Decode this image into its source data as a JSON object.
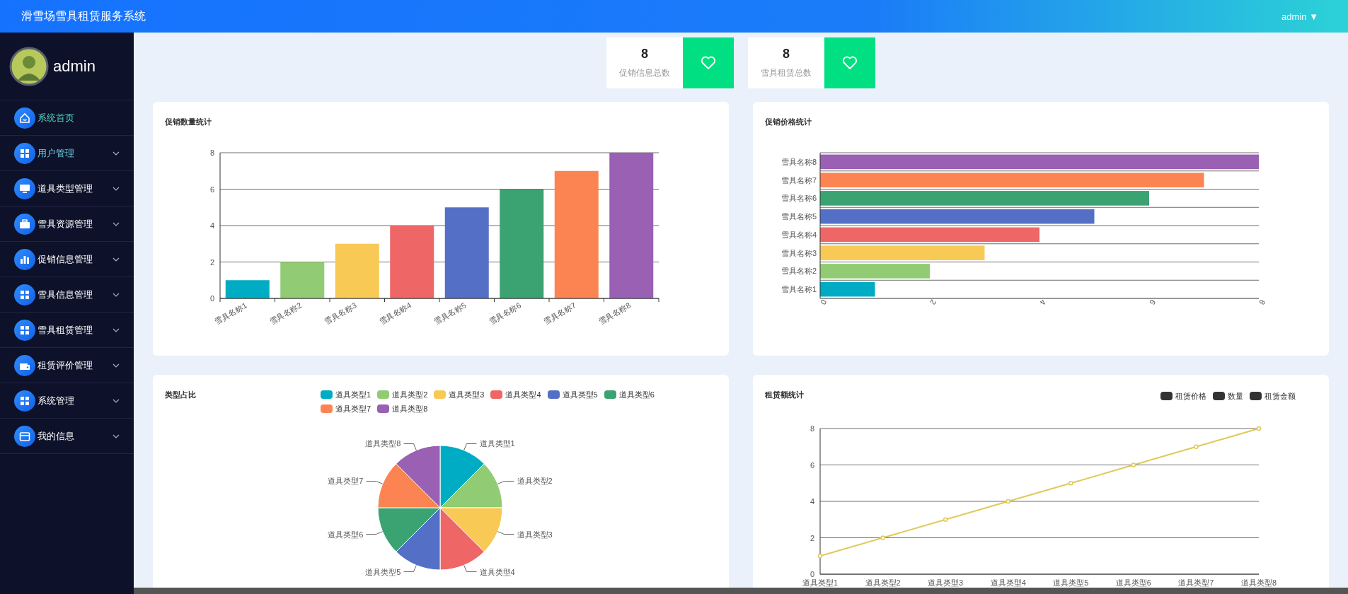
{
  "top_bar": {
    "title": "滑雪场雪具租赁服务系统",
    "user": "admin",
    "caret": "▼"
  },
  "sidebar": {
    "user": "admin",
    "items": [
      {
        "label": "系统首页",
        "kind": "home",
        "selected": true,
        "hovered": false
      },
      {
        "label": "用户管理",
        "kind": "grid",
        "selected": false,
        "hovered": true,
        "expanded": false
      },
      {
        "label": "道具类型管理",
        "kind": "monitor",
        "selected": false,
        "hovered": false,
        "expanded": false
      },
      {
        "label": "雪具资源管理",
        "kind": "briefcase",
        "selected": false,
        "hovered": false,
        "expanded": false
      },
      {
        "label": "促销信息管理",
        "kind": "barchart",
        "selected": false,
        "hovered": false,
        "expanded": false
      },
      {
        "label": "雪具信息管理",
        "kind": "grid",
        "selected": false,
        "hovered": false,
        "expanded": false
      },
      {
        "label": "雪具租赁管理",
        "kind": "grid",
        "selected": false,
        "hovered": false,
        "expanded": false
      },
      {
        "label": "租赁评价管理",
        "kind": "wallet",
        "selected": false,
        "hovered": false,
        "expanded": false
      },
      {
        "label": "系统管理",
        "kind": "grid",
        "selected": false,
        "hovered": false,
        "expanded": false
      },
      {
        "label": "我的信息",
        "kind": "card",
        "selected": false,
        "hovered": false,
        "expanded": false
      }
    ]
  },
  "stats": [
    {
      "value": "8",
      "label": "促销信息总数"
    },
    {
      "value": "8",
      "label": "雪具租赁总数"
    }
  ],
  "panels": [
    {
      "title": "促销数量统计",
      "bars": [
        {
          "color": "#00acc4"
        },
        {
          "color": "#91cc75"
        },
        {
          "color": "#f9c956"
        },
        {
          "color": "#ee6666"
        },
        {
          "color": "#5470c6"
        },
        {
          "color": "#3ba272"
        },
        {
          "color": "#fc8452"
        },
        {
          "color": "#9a60b4"
        }
      ],
      "chart_data": {
        "type": "bar",
        "grid": true,
        "categories": [
          "雪具名称1",
          "雪具名称2",
          "雪具名称3",
          "雪具名称4",
          "雪具名称5",
          "雪具名称6",
          "雪具名称7",
          "雪具名称8"
        ],
        "values": [
          1,
          2,
          3,
          4,
          5,
          6,
          7,
          8
        ],
        "ylim": [
          0,
          8
        ],
        "yticks": [
          0,
          2,
          4,
          6,
          8
        ]
      }
    },
    {
      "title": "促销价格统计",
      "bars": [
        {
          "color": "#9a60b4"
        },
        {
          "color": "#fc8452"
        },
        {
          "color": "#3ba272"
        },
        {
          "color": "#5470c6"
        },
        {
          "color": "#ee6666"
        },
        {
          "color": "#f9c956"
        },
        {
          "color": "#91cc75"
        },
        {
          "color": "#00acc4"
        }
      ],
      "chart_data": {
        "type": "bar",
        "orientation": "horizontal",
        "grid": true,
        "categories": [
          "雪具名称8",
          "雪具名称7",
          "雪具名称6",
          "雪具名称5",
          "雪具名称4",
          "雪具名称3",
          "雪具名称2",
          "雪具名称1"
        ],
        "values": [
          8,
          7,
          6,
          5,
          4,
          3,
          2,
          1
        ],
        "xlim": [
          0,
          8
        ],
        "xticks": [
          0,
          2,
          4,
          6,
          8
        ]
      }
    },
    {
      "title": "类型占比",
      "legend": [
        {
          "label": "道具类型1",
          "color": "#00acc4"
        },
        {
          "label": "道具类型2",
          "color": "#91cc75"
        },
        {
          "label": "道具类型3",
          "color": "#f9c956"
        },
        {
          "label": "道具类型4",
          "color": "#ee6666"
        },
        {
          "label": "道具类型5",
          "color": "#5470c6"
        },
        {
          "label": "道具类型6",
          "color": "#3ba272"
        },
        {
          "label": "道具类型7",
          "color": "#fc8452"
        },
        {
          "label": "道具类型8",
          "color": "#9a60b4"
        }
      ],
      "bars": [
        {
          "color": "#00acc4"
        },
        {
          "color": "#91cc75"
        },
        {
          "color": "#f9c956"
        },
        {
          "color": "#ee6666"
        },
        {
          "color": "#5470c6"
        },
        {
          "color": "#3ba272"
        },
        {
          "color": "#fc8452"
        },
        {
          "color": "#9a60b4"
        }
      ],
      "chart_data": {
        "type": "pie",
        "categories": [
          "道具类型1",
          "道具类型2",
          "道具类型3",
          "道具类型4",
          "道具类型5",
          "道具类型6",
          "道具类型7",
          "道具类型8"
        ],
        "values": [
          1,
          1,
          1,
          1,
          1,
          1,
          1,
          1
        ]
      }
    },
    {
      "title": "租赁额统计",
      "legend": [
        {
          "label": "租赁价格"
        },
        {
          "label": "数量"
        },
        {
          "label": "租赁金额"
        }
      ],
      "chart_data": {
        "type": "line",
        "grid": true,
        "categories": [
          "道具类型1",
          "道具类型2",
          "道具类型3",
          "道具类型4",
          "道具类型5",
          "道具类型6",
          "道具类型7",
          "道具类型8"
        ],
        "series": [
          {
            "color": "#e0c95a",
            "marker": true,
            "values": [
              1,
              2,
              3,
              4,
              5,
              6,
              7,
              8
            ]
          }
        ],
        "ylim": [
          0,
          8
        ],
        "yticks": [
          0,
          2,
          4,
          6,
          8
        ]
      }
    }
  ]
}
